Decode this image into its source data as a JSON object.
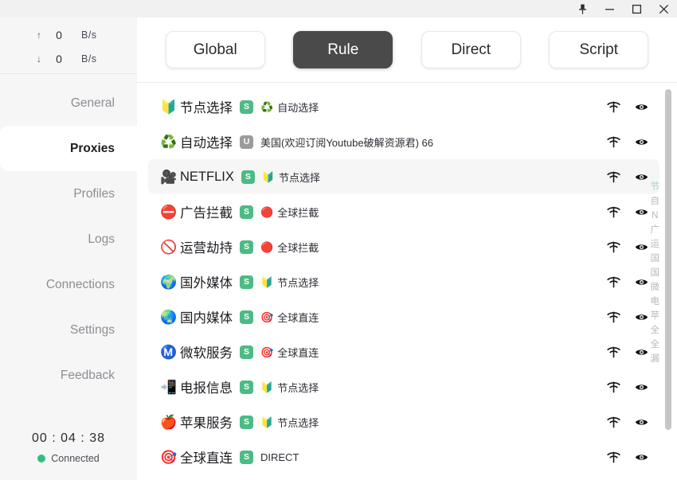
{
  "titlebar": {
    "buttons": [
      {
        "name": "pin-icon",
        "label": "Pin"
      },
      {
        "name": "minimize-icon",
        "label": "Minimize"
      },
      {
        "name": "maximize-icon",
        "label": "Maximize"
      },
      {
        "name": "close-icon",
        "label": "Close"
      }
    ]
  },
  "sidebar": {
    "traffic": [
      {
        "arrow": "↑",
        "value": "0",
        "unit": "B/s"
      },
      {
        "arrow": "↓",
        "value": "0",
        "unit": "B/s"
      }
    ],
    "items": [
      {
        "label": "General",
        "active": false
      },
      {
        "label": "Proxies",
        "active": true
      },
      {
        "label": "Profiles",
        "active": false
      },
      {
        "label": "Logs",
        "active": false
      },
      {
        "label": "Connections",
        "active": false
      },
      {
        "label": "Settings",
        "active": false
      },
      {
        "label": "Feedback",
        "active": false
      }
    ],
    "status": {
      "timer": "00 : 04 : 38",
      "connection": "Connected",
      "dot_color": "#2fc17f"
    }
  },
  "main": {
    "modes": [
      {
        "label": "Global",
        "active": false
      },
      {
        "label": "Rule",
        "active": true
      },
      {
        "label": "Direct",
        "active": false
      },
      {
        "label": "Script",
        "active": false
      }
    ],
    "accent_active_bg": "#4a4a4a",
    "badge_s_color": "#4cbb84",
    "badge_u_color": "#9b9b9b",
    "rows": [
      {
        "emoji": "🔰",
        "name": "节点选择",
        "badge": "S",
        "badge_type": "s",
        "sub_emoji": "♻️",
        "sub": "自动选择",
        "selected": false
      },
      {
        "emoji": "♻️",
        "name": "自动选择",
        "badge": "U",
        "badge_type": "u",
        "sub_emoji": "",
        "sub": "美国(欢迎订阅Youtube破解资源君) 66",
        "selected": false
      },
      {
        "emoji": "🎥",
        "name": "NETFLIX",
        "badge": "S",
        "badge_type": "s",
        "sub_emoji": "🔰",
        "sub": "节点选择",
        "selected": true
      },
      {
        "emoji": "⛔",
        "name": "广告拦截",
        "badge": "S",
        "badge_type": "s",
        "sub_emoji": "🔴",
        "sub": "全球拦截",
        "selected": false
      },
      {
        "emoji": "🚫",
        "name": "运营劫持",
        "badge": "S",
        "badge_type": "s",
        "sub_emoji": "🔴",
        "sub": "全球拦截",
        "selected": false
      },
      {
        "emoji": "🌍",
        "name": "国外媒体",
        "badge": "S",
        "badge_type": "s",
        "sub_emoji": "🔰",
        "sub": "节点选择",
        "selected": false
      },
      {
        "emoji": "🌏",
        "name": "国内媒体",
        "badge": "S",
        "badge_type": "s",
        "sub_emoji": "🎯",
        "sub": "全球直连",
        "selected": false
      },
      {
        "emoji": "Ⓜ️",
        "name": "微软服务",
        "badge": "S",
        "badge_type": "s",
        "sub_emoji": "🎯",
        "sub": "全球直连",
        "selected": false
      },
      {
        "emoji": "📲",
        "name": "电报信息",
        "badge": "S",
        "badge_type": "s",
        "sub_emoji": "🔰",
        "sub": "节点选择",
        "selected": false
      },
      {
        "emoji": "🍎",
        "name": "苹果服务",
        "badge": "S",
        "badge_type": "s",
        "sub_emoji": "🔰",
        "sub": "节点选择",
        "selected": false
      },
      {
        "emoji": "🎯",
        "name": "全球直连",
        "badge": "S",
        "badge_type": "s",
        "sub_emoji": "",
        "sub": "DIRECT",
        "selected": false
      }
    ],
    "row_actions": [
      {
        "name": "speed-test-icon"
      },
      {
        "name": "eye-icon"
      }
    ],
    "quick_index": [
      "节",
      "自",
      "N",
      "广",
      "运",
      "国",
      "国",
      "微",
      "电",
      "苹",
      "全",
      "全",
      "漏"
    ]
  }
}
